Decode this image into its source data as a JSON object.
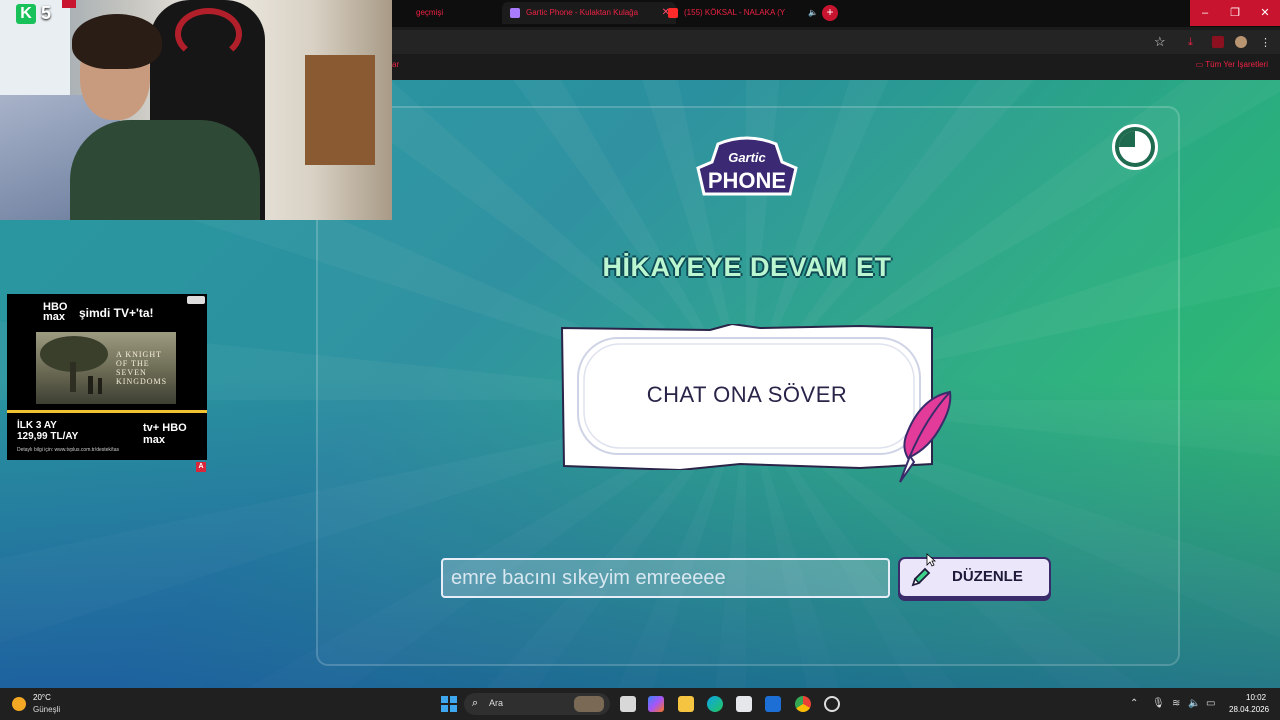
{
  "browser": {
    "tabs": [
      {
        "label": "geçmişi",
        "color": "#e24"
      },
      {
        "label": "Gartic Phone - Kulaktan Kulağa",
        "color": "#a87bff"
      },
      {
        "label": "(155) KÖKSAL - NALAKA (Y",
        "color": "#ff2a2a"
      }
    ],
    "new_tab": "+",
    "bookmarks_right": "Tüm Yer İşaretleri",
    "window_controls": [
      "–",
      "❐",
      "✕"
    ]
  },
  "webcam": {
    "badge_letter": "K",
    "badge_count": "5"
  },
  "ad": {
    "brand": "HBO max",
    "headline": "şimdi TV+'ta!",
    "movie_title": "A KNIGHT OF THE SEVEN KINGDOMS",
    "offer_line1": "İLK 3 AY",
    "offer_line2": "129,99 TL/AY",
    "badge": "tv+ HBO max",
    "fine_print": "Detaylı bilgi için: www.tvplus.com.tr/destek/tas",
    "marker": "A"
  },
  "game": {
    "logo_top": "Gartic",
    "logo_bottom": "PHONE",
    "title": "HİKAYEYE DEVAM ET",
    "prompt_text": "CHAT ONA SÖVER",
    "input_value": "emre bacını sıkeyim emreeeee",
    "edit_button": "DÜZENLE"
  },
  "taskbar": {
    "temperature": "20°C",
    "condition": "Güneşli",
    "search_label": "Ara",
    "time": "10:02",
    "date": "28.04.2026"
  },
  "colors": {
    "title_fill": "#baf7d0",
    "title_outline": "#0f4a55",
    "button_bg": "#ece6fb",
    "button_border": "#3a2c6b",
    "close_red": "#c8142f"
  }
}
